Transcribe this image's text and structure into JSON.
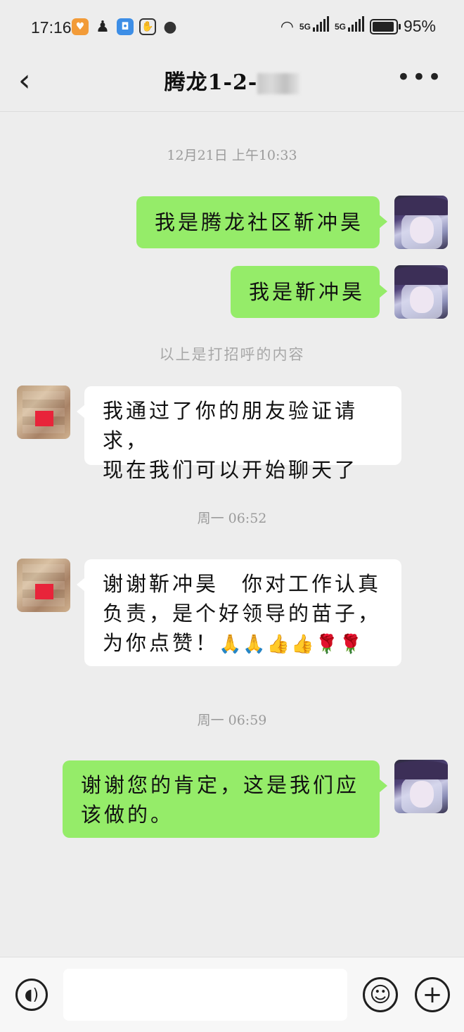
{
  "status_bar": {
    "time": "17:16",
    "net1": "5G",
    "net2": "5G",
    "battery": "95%",
    "battery_level": 0.95
  },
  "header": {
    "title": "腾龙1-2-",
    "back_icon": "chevron-left-icon",
    "more_icon": "more-dots-icon"
  },
  "messages": [
    {
      "type": "timestamp",
      "text": "12月21日 上午10:33"
    },
    {
      "type": "bubble",
      "from": "me",
      "text": "我是腾龙社区靳冲昊"
    },
    {
      "type": "bubble",
      "from": "me",
      "text": "我是靳冲昊"
    },
    {
      "type": "system",
      "text": "以上是打招呼的内容"
    },
    {
      "type": "bubble",
      "from": "other",
      "lines": [
        "我通过了你的朋友验证请求，",
        "现在我们可以开始聊天了"
      ]
    },
    {
      "type": "timestamp",
      "text": "周一 06:52"
    },
    {
      "type": "bubble",
      "from": "other",
      "lines": [
        "谢谢靳冲昊　你对工作认真",
        "负责，是个好领导的苗子，",
        "为你点赞！"
      ],
      "emoji": "🙏🙏👍👍🌹🌹"
    },
    {
      "type": "timestamp",
      "text": "周一 06:59"
    },
    {
      "type": "bubble",
      "from": "me",
      "lines": [
        "谢谢您的肯定，这是我们应",
        "该做的。"
      ]
    }
  ],
  "input_bar": {
    "voice_icon": "voice-icon",
    "input_value": "",
    "emoji_icon": "emoji-icon",
    "plus_icon": "plus-icon"
  },
  "colors": {
    "background": "#ededed",
    "my_bubble": "#95ec69",
    "other_bubble": "#ffffff"
  }
}
